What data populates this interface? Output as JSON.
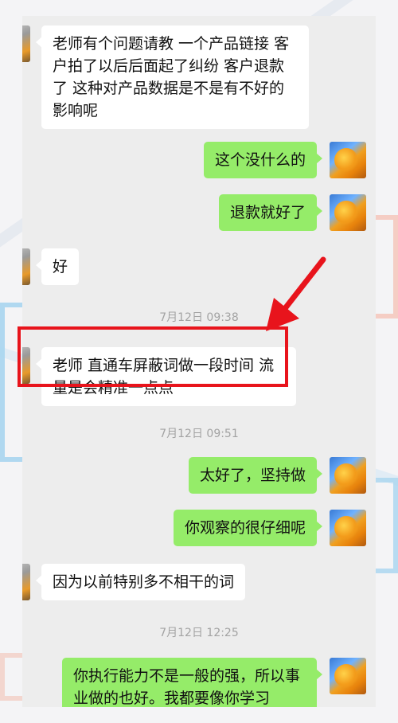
{
  "conversation": {
    "messages": [
      {
        "side": "in",
        "text": "老师有个问题请教 一个产品链接 客户拍了以后后面起了纠纷 客户退款了 这种对产品数据是不是有不好的影响呢"
      },
      {
        "side": "out",
        "text": "这个没什么的"
      },
      {
        "side": "out",
        "text": "退款就好了"
      },
      {
        "side": "in",
        "text": "好"
      },
      {
        "side": "in",
        "text": "老师 直通车屏蔽词做一段时间 流量是会精准一点点",
        "highlighted": true
      },
      {
        "side": "out",
        "text": "太好了，坚持做"
      },
      {
        "side": "out",
        "text": "你观察的很仔细呢"
      },
      {
        "side": "in",
        "text": "因为以前特别多不相干的词"
      },
      {
        "side": "out",
        "text": "你执行能力不是一般的强，所以事业做的也好。我都要像你学习"
      }
    ],
    "timestamps": [
      "7月12日 09:38",
      "7月12日 09:51",
      "7月12日 12:25"
    ]
  },
  "annotation": {
    "color": "#e8141c"
  },
  "colors": {
    "outgoing_bubble": "#95ec69",
    "incoming_bubble": "#ffffff",
    "chat_bg": "#ededed"
  }
}
